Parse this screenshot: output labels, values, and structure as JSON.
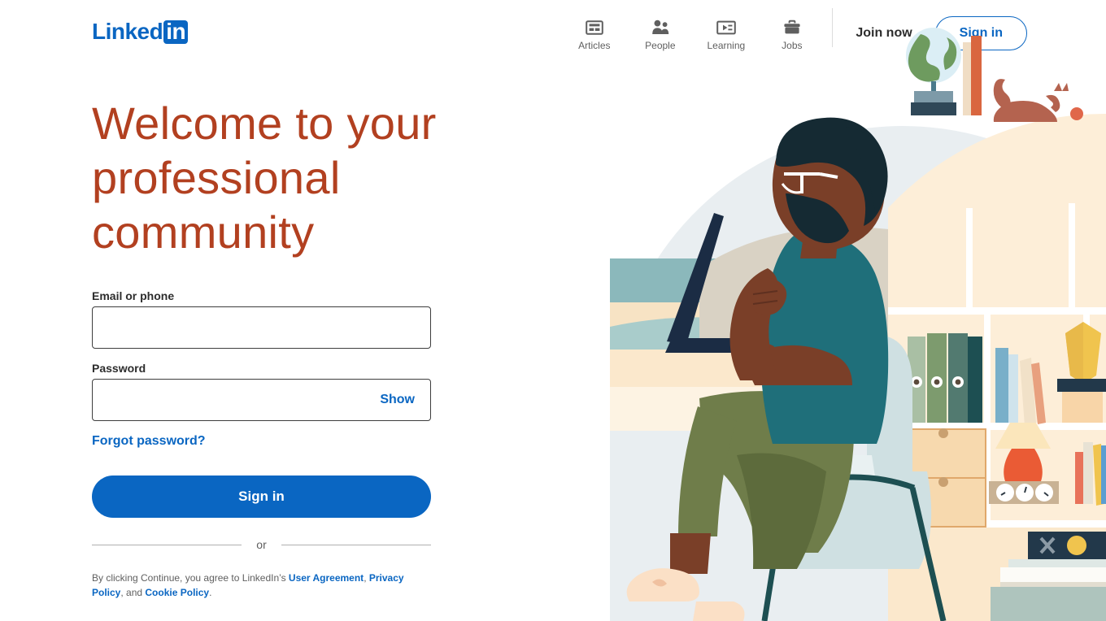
{
  "header": {
    "logo": {
      "word": "Linked",
      "box": "in",
      "color": "#0a66c2"
    },
    "nav": [
      {
        "label": "Articles",
        "icon": "articles-icon"
      },
      {
        "label": "People",
        "icon": "people-icon"
      },
      {
        "label": "Learning",
        "icon": "learning-icon"
      },
      {
        "label": "Jobs",
        "icon": "jobs-icon"
      }
    ],
    "join_label": "Join now",
    "signin_label": "Sign in"
  },
  "main": {
    "headline": "Welcome to your professional community",
    "headline_color": "#b24020",
    "email": {
      "label": "Email or phone",
      "value": "",
      "placeholder": ""
    },
    "password": {
      "label": "Password",
      "value": "",
      "placeholder": "",
      "show_label": "Show"
    },
    "forgot_label": "Forgot password?",
    "submit_label": "Sign in",
    "or_label": "or",
    "legal": {
      "prefix": "By clicking Continue, you agree to LinkedIn’s ",
      "link1": "User Agreement",
      "sep1": ", ",
      "link2": "Privacy Policy",
      "sep2": ", and ",
      "link3": "Cookie Policy",
      "suffix": "."
    },
    "accent_color": "#0a66c2"
  },
  "illustration": {
    "name": "person-working-on-laptop-illustration",
    "elements": [
      "sky-blob",
      "clouds",
      "beach",
      "laptop",
      "person",
      "armchair",
      "bookshelf",
      "globe",
      "cat",
      "binders",
      "lamp",
      "vase",
      "clocks",
      "books"
    ]
  }
}
